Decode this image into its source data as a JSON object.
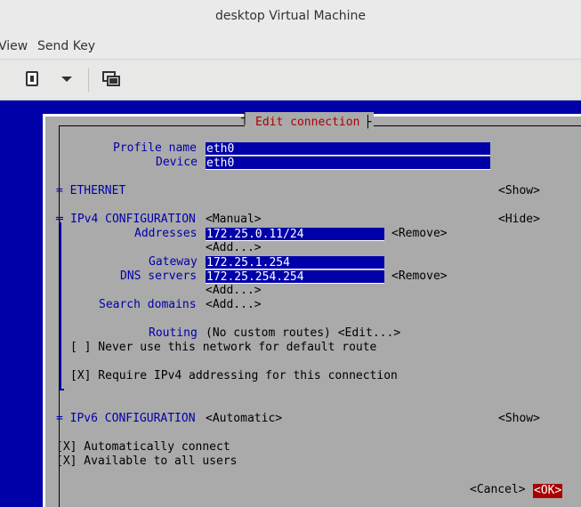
{
  "window": {
    "title": "desktop Virtual Machine"
  },
  "menubar": {
    "view": "View",
    "send_key": "Send Key"
  },
  "toolbar": {
    "icons": [
      "usb-redirect-icon",
      "dropdown-arrow-icon",
      "screenshot-icon"
    ]
  },
  "dialog": {
    "title": "Edit connection",
    "profile_name_label": "Profile name",
    "profile_name_value": "eth0",
    "device_label": "Device",
    "device_value": "eth0",
    "ethernet_header": "= ETHERNET",
    "ethernet_show": "<Show>",
    "ipv4": {
      "header": "IPv4 CONFIGURATION",
      "mode": "<Manual>",
      "hide": "<Hide>",
      "addresses_label": "Addresses",
      "address_value": "172.25.0.11/24",
      "remove_1": "<Remove>",
      "add_1": "<Add...>",
      "gateway_label": "Gateway",
      "gateway_value": "172.25.1.254",
      "dns_label": "DNS servers",
      "dns_value": "172.25.254.254",
      "remove_2": "<Remove>",
      "add_2": "<Add...>",
      "search_label": "Search domains",
      "search_add": "<Add...>",
      "routing_label": "Routing",
      "routing_value": "(No custom routes) <Edit...>",
      "never_default": "[ ] Never use this network for default route",
      "require_ipv4": "[X] Require IPv4 addressing for this connection"
    },
    "ipv6": {
      "header": "= IPv6 CONFIGURATION",
      "mode": "<Automatic>",
      "show": "<Show>"
    },
    "auto_connect": "[X] Automatically connect",
    "all_users": "[X] Available to all users",
    "cancel": "<Cancel>",
    "ok": "<OK>"
  }
}
